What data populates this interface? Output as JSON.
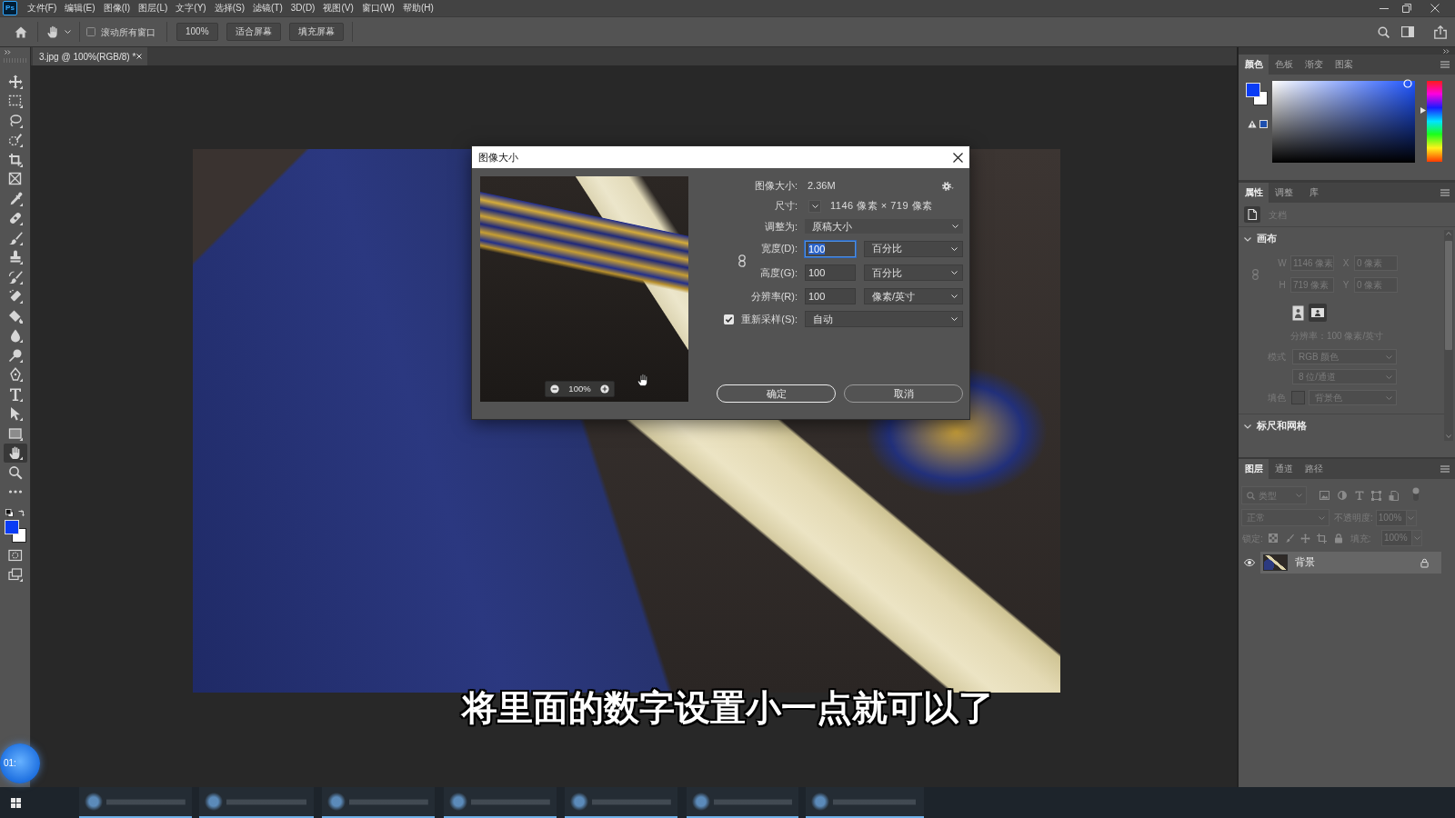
{
  "menu_bar": {
    "logo": "Ps",
    "items": [
      "文件(F)",
      "编辑(E)",
      "图像(I)",
      "图层(L)",
      "文字(Y)",
      "选择(S)",
      "滤镜(T)",
      "3D(D)",
      "视图(V)",
      "窗口(W)",
      "帮助(H)"
    ]
  },
  "options_bar": {
    "scroll_all_windows": {
      "label": "滚动所有窗口",
      "checked": false
    },
    "buttons": [
      "100%",
      "适合屏幕",
      "填充屏幕"
    ]
  },
  "tools": [
    {
      "kind": "move",
      "selected": false
    },
    {
      "kind": "marquee",
      "selected": false
    },
    {
      "kind": "lasso",
      "selected": false
    },
    {
      "kind": "quick_select",
      "selected": false
    },
    {
      "kind": "crop",
      "selected": false
    },
    {
      "kind": "frame",
      "selected": false
    },
    {
      "kind": "eyedropper",
      "selected": false
    },
    {
      "kind": "healing",
      "selected": false
    },
    {
      "kind": "brush",
      "selected": false
    },
    {
      "kind": "stamp",
      "selected": false
    },
    {
      "kind": "history_brush",
      "selected": false
    },
    {
      "kind": "eraser",
      "selected": false
    },
    {
      "kind": "bucket",
      "selected": false
    },
    {
      "kind": "blur",
      "selected": false
    },
    {
      "kind": "dodge",
      "selected": false
    },
    {
      "kind": "pen",
      "selected": false
    },
    {
      "kind": "type",
      "selected": false
    },
    {
      "kind": "path_select",
      "selected": false
    },
    {
      "kind": "rectangle",
      "selected": false
    },
    {
      "kind": "hand",
      "selected": true
    },
    {
      "kind": "zoom",
      "selected": false
    },
    {
      "kind": "more",
      "selected": false
    }
  ],
  "view_tools": [
    {
      "kind": "quick_mask",
      "selected": false
    },
    {
      "kind": "screen_mode",
      "selected": false
    }
  ],
  "document_tabs": [
    {
      "title": "3.jpg @ 100%(RGB/8) *",
      "selected": true
    }
  ],
  "dialog": {
    "title": "图像大小",
    "preview_zoom": "100%",
    "image_size": {
      "label": "图像大小:",
      "value": "2.36M"
    },
    "dimensions": {
      "label": "尺寸:",
      "value": "1146 像素 × 719 像素"
    },
    "fit_to": {
      "label": "调整为:",
      "value": "原稿大小"
    },
    "fields": [
      {
        "label": "宽度(D):",
        "value": "100",
        "unit": "百分比",
        "focused": true
      },
      {
        "label": "高度(G):",
        "value": "100",
        "unit": "百分比",
        "focused": false
      },
      {
        "label": "分辨率(R):",
        "value": "100",
        "unit": "像素/英寸",
        "focused": false
      }
    ],
    "resample": {
      "label": "重新采样(S):",
      "checked": true,
      "value": "自动"
    },
    "buttons": [
      {
        "label": "确定",
        "default": true
      },
      {
        "label": "取消",
        "default": false
      }
    ]
  },
  "color_panel": {
    "tabs": [
      {
        "label": "颜色",
        "selected": true
      },
      {
        "label": "色板",
        "selected": false
      },
      {
        "label": "渐变",
        "selected": false
      },
      {
        "label": "图案",
        "selected": false
      }
    ],
    "hue": {
      "level": 0.64
    }
  },
  "properties_panel": {
    "tabs": [
      {
        "label": "属性",
        "selected": true
      },
      {
        "label": "调整",
        "selected": false
      },
      {
        "label": "库",
        "selected": false
      }
    ],
    "document_label": "文档",
    "disabled": true,
    "canvas_section": {
      "title": "画布",
      "w_label": "W",
      "w": "1146 像素",
      "x_label": "X",
      "x": "0 像素",
      "h_label": "H",
      "h": "719 像素",
      "y_label": "Y",
      "y": "0 像素",
      "resolution": "分辨率：100 像素/英寸",
      "mode_label": "模式",
      "mode": "RGB 颜色",
      "bit_depth": "8 位/通道",
      "fill_label": "填色",
      "fill": "背景色"
    },
    "rulers_section": {
      "title": "标尺和网格"
    }
  },
  "layers_panel": {
    "tabs": [
      {
        "label": "图层",
        "selected": true
      },
      {
        "label": "通道",
        "selected": false
      },
      {
        "label": "路径",
        "selected": false
      }
    ],
    "disabled": true,
    "filter": "类型",
    "blend_mode": "正常",
    "opacity_label": "不透明度:",
    "opacity": "100%",
    "lock_label": "锁定:",
    "fill_label": "填充:",
    "fill": "100%",
    "layers": [
      {
        "name": "背景",
        "visible": true,
        "locked": true,
        "selected": true
      }
    ]
  },
  "caption": "将里面的数字设置小一点就可以了",
  "recording_timer": "01:"
}
